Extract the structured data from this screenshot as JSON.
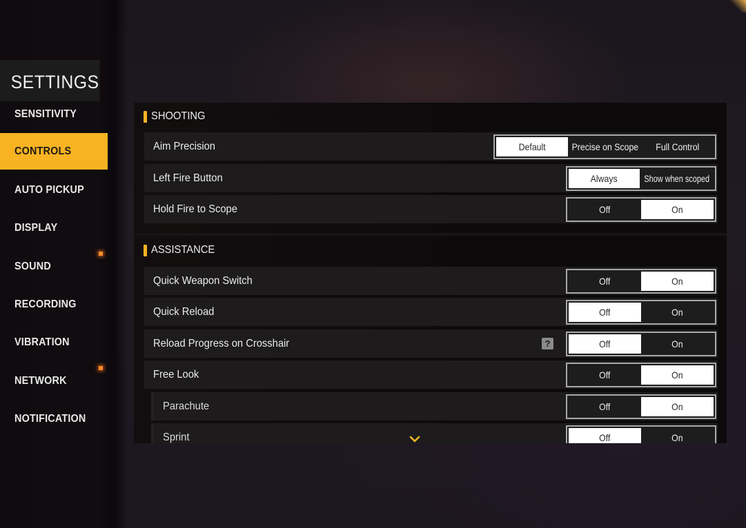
{
  "sidebar": {
    "title": "SETTINGS",
    "items": [
      {
        "label": "SENSITIVITY",
        "active": false,
        "dot": false
      },
      {
        "label": "CONTROLS",
        "active": true,
        "dot": false
      },
      {
        "label": "AUTO PICKUP",
        "active": false,
        "dot": false
      },
      {
        "label": "DISPLAY",
        "active": false,
        "dot": true
      },
      {
        "label": "SOUND",
        "active": false,
        "dot": false
      },
      {
        "label": "RECORDING",
        "active": false,
        "dot": false
      },
      {
        "label": "VIBRATION",
        "active": false,
        "dot": true
      },
      {
        "label": "NETWORK",
        "active": false,
        "dot": false
      },
      {
        "label": "NOTIFICATION",
        "active": false,
        "dot": false
      }
    ],
    "accent_color": "#f8b323",
    "notification_dot_color": "#ff8a2a"
  },
  "sections": [
    {
      "title": "SHOOTING",
      "rows": [
        {
          "label": "Aim Precision",
          "options": [
            "Default",
            "Precise on Scope",
            "Full Control"
          ],
          "selected": 0,
          "sub": false,
          "help": false
        },
        {
          "label": "Left Fire Button",
          "options": [
            "Always",
            "Show when scoped"
          ],
          "selected": 0,
          "sub": false,
          "help": false
        },
        {
          "label": "Hold Fire to Scope",
          "options": [
            "Off",
            "On"
          ],
          "selected": 1,
          "sub": false,
          "help": false
        }
      ]
    },
    {
      "title": "ASSISTANCE",
      "rows": [
        {
          "label": "Quick Weapon Switch",
          "options": [
            "Off",
            "On"
          ],
          "selected": 1,
          "sub": false,
          "help": false
        },
        {
          "label": "Quick Reload",
          "options": [
            "Off",
            "On"
          ],
          "selected": 0,
          "sub": false,
          "help": false
        },
        {
          "label": "Reload Progress on Crosshair",
          "options": [
            "Off",
            "On"
          ],
          "selected": 0,
          "sub": false,
          "help": true
        },
        {
          "label": "Free Look",
          "options": [
            "Off",
            "On"
          ],
          "selected": 1,
          "sub": false,
          "help": false
        },
        {
          "label": "Parachute",
          "options": [
            "Off",
            "On"
          ],
          "selected": 1,
          "sub": true,
          "help": false
        },
        {
          "label": "Sprint",
          "options": [
            "Off",
            "On"
          ],
          "selected": 0,
          "sub": true,
          "help": false
        }
      ]
    }
  ],
  "icons": {
    "help": "?",
    "scroll_more": "chevron-down-icon",
    "section_marker_color": "#f5b324"
  }
}
